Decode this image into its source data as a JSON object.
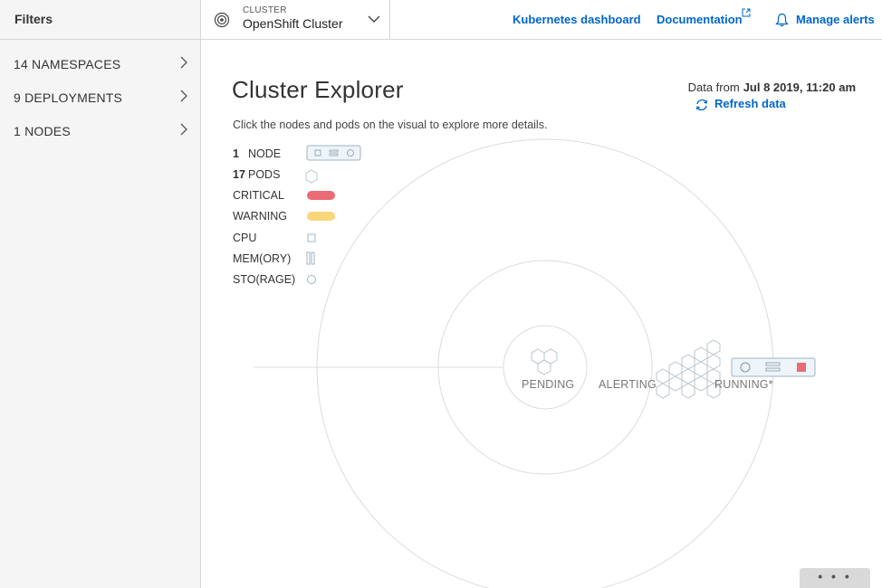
{
  "sidebar": {
    "title": "Filters",
    "items": [
      {
        "label": "14 NAMESPACES"
      },
      {
        "label": "9 DEPLOYMENTS"
      },
      {
        "label": "1 NODES"
      }
    ]
  },
  "header": {
    "cluster_label": "CLUSTER",
    "cluster_value": "OpenShift Cluster",
    "links": {
      "kubernetes": "Kubernetes dashboard",
      "documentation": "Documentation",
      "alerts": "Manage alerts"
    }
  },
  "main": {
    "title": "Cluster Explorer",
    "subtitle": "Click the nodes and pods on the visual to explore more details.",
    "data_from_label": "Data from",
    "data_from_value": "Jul 8 2019, 11:20 am",
    "refresh_label": "Refresh data"
  },
  "legend": {
    "node_count": "1",
    "node_label": "NODE",
    "pods_count": "17",
    "pods_label": "PODS",
    "critical": "CRITICAL",
    "warning": "WARNING",
    "cpu": "CPU",
    "memory": "MEM(ORY)",
    "storage": "STO(RAGE)"
  },
  "visual": {
    "pending_label": "PENDING",
    "alerting_label": "ALERTING",
    "running_label": "RUNNING*"
  },
  "colors": {
    "critical": "#ea6b73",
    "warning": "#f9d67a",
    "link": "#0066cc"
  },
  "more_label": "• • •"
}
